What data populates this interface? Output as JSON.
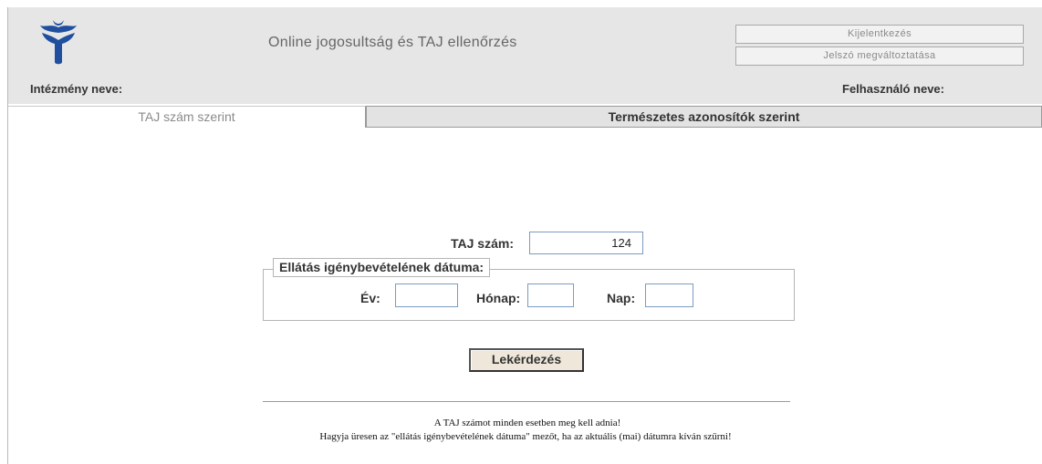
{
  "header": {
    "title": "Online jogosultság és TAJ ellenőrzés",
    "logout_label": "Kijelentkezés",
    "change_password_label": "Jelszó megváltoztatása",
    "institution_label": "Intézmény neve:",
    "user_label": "Felhasználó neve:",
    "logo_icon": "stylized-tree-logo-icon",
    "logo_color": "#1f4f9e"
  },
  "tabs": [
    {
      "label": "TAJ szám szerint",
      "active": true
    },
    {
      "label": "Természetes azonosítók szerint",
      "active": false
    }
  ],
  "form": {
    "taj_label": "TAJ szám:",
    "taj_value": "124",
    "date_legend": "Ellátás igénybevételének dátuma:",
    "year_label": "Év:",
    "year_value": "",
    "month_label": "Hónap:",
    "month_value": "",
    "day_label": "Nap:",
    "day_value": "",
    "submit_label": "Lekérdezés"
  },
  "notes": {
    "line1": "A TAJ számot minden esetben meg kell adnia!",
    "line2": "Hagyja üresen az \"ellátás igénybevételének dátuma\" mezőt, ha az aktuális (mai) dátumra kíván szűrni!"
  }
}
